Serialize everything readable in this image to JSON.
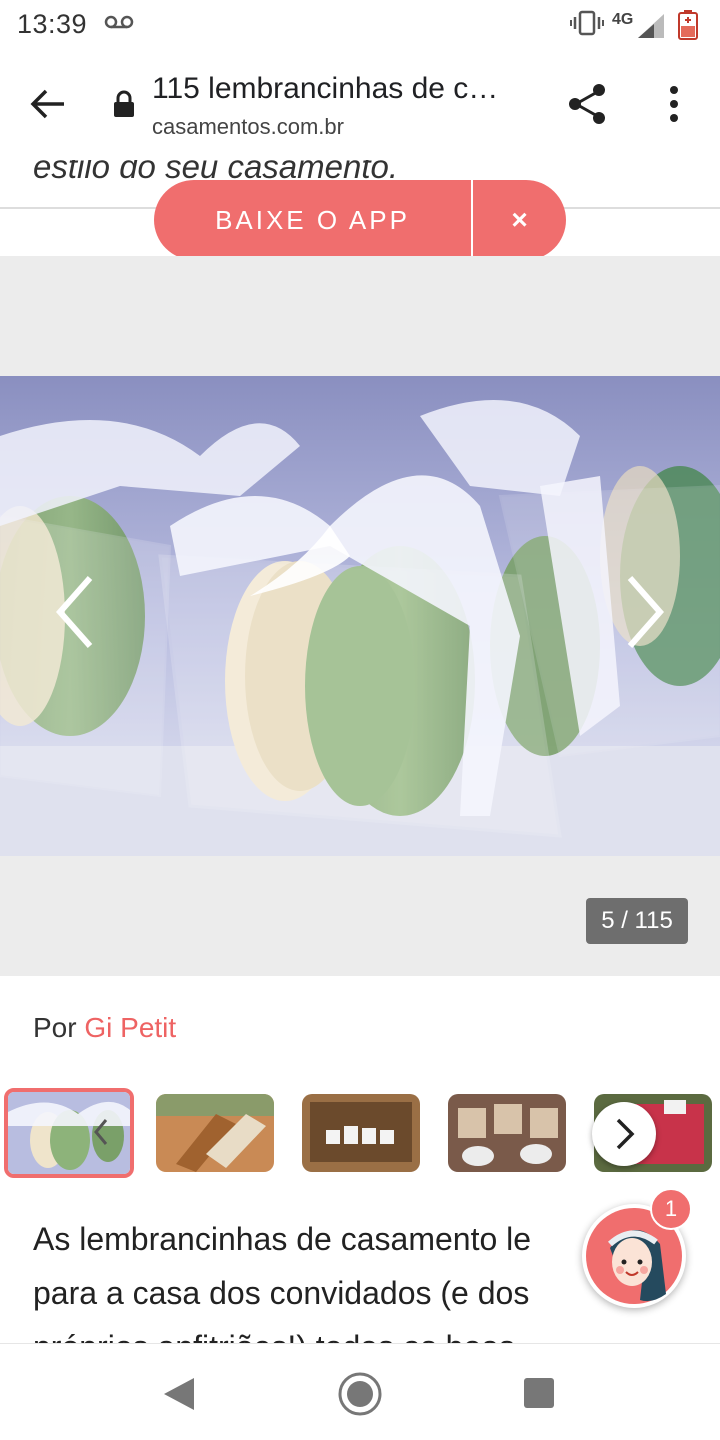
{
  "status_bar": {
    "time": "13:39",
    "network": "4G",
    "icons": [
      "voicemail-icon",
      "vibrate-icon",
      "signal-icon",
      "battery-icon"
    ]
  },
  "browser": {
    "title": "115 lembrancinhas de c…",
    "domain": "casamentos.com.br",
    "icons": [
      "back-arrow-icon",
      "lock-icon",
      "share-icon",
      "more-vert-icon"
    ]
  },
  "page": {
    "intro_tail": "estilo do seu casamento.",
    "app_banner": {
      "label": "BAIXE O APP",
      "close": "×"
    },
    "gallery": {
      "counter": "5 / 115",
      "image": "macarons-in-clear-boxes-with-ribbon"
    },
    "author": {
      "prefix": "Por",
      "name": "Gi Petit"
    },
    "thumbnails": [
      "macarons-boxes",
      "wooden-fans",
      "jars-on-shelf",
      "wrapped-sweets",
      "red-bags"
    ],
    "article_lines": [
      "As lembrancinhas de casamento le",
      "para a casa dos convidados (e dos",
      "próprios anfitriões!) todas as boas"
    ],
    "chat": {
      "badge": "1"
    }
  },
  "colors": {
    "accent": "#f06e6e",
    "gallery_bg": "#ececec",
    "counter_bg": "#6e6e6e"
  },
  "nav_bar": {
    "icons": [
      "nav-back-icon",
      "nav-home-icon",
      "nav-recents-icon"
    ]
  }
}
